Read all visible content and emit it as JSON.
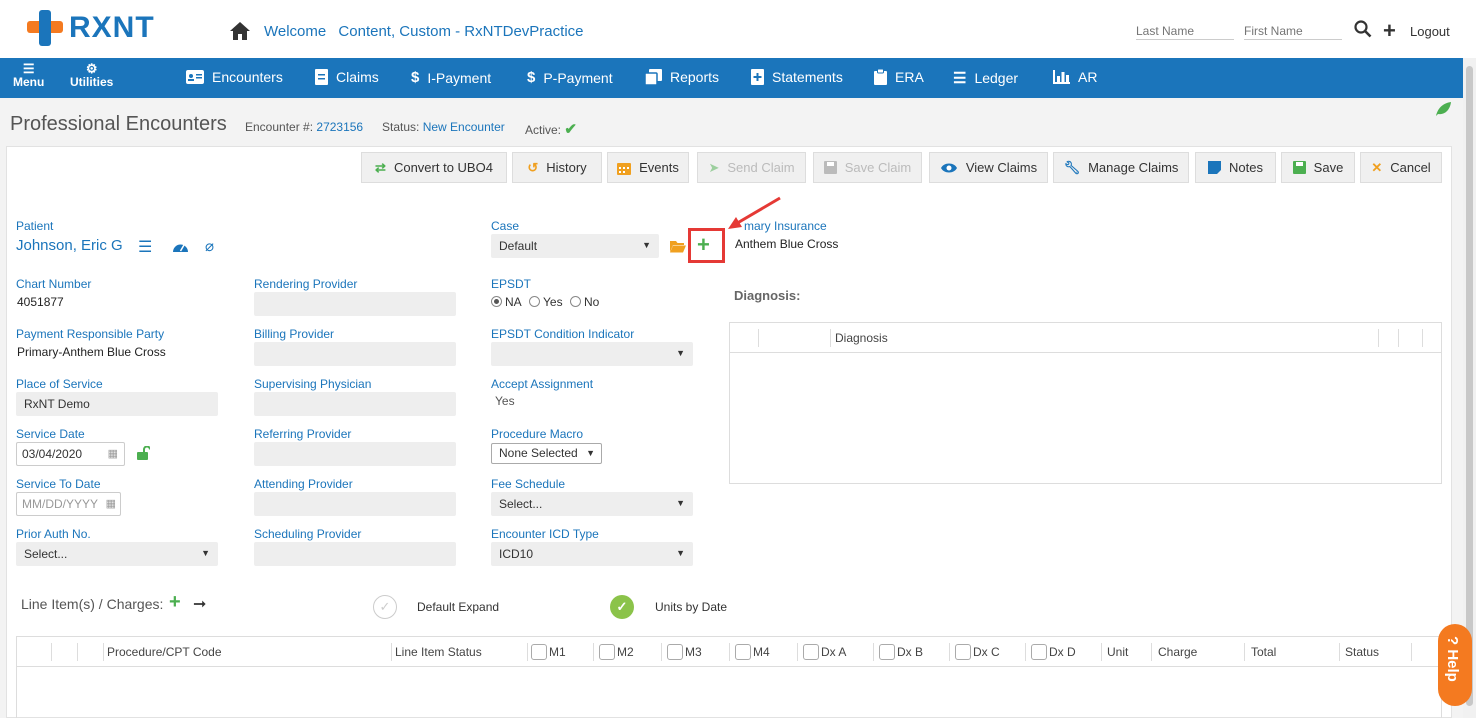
{
  "brand": {
    "logo_text": "RXNT"
  },
  "header": {
    "welcome_label": "Welcome",
    "user": "Content, Custom - RxNTDevPractice",
    "last_name_placeholder": "Last Name",
    "first_name_placeholder": "First Name",
    "logout": "Logout"
  },
  "nav": {
    "menu": "Menu",
    "utilities": "Utilities",
    "items": [
      {
        "label": "Encounters",
        "icon": "id-card-icon"
      },
      {
        "label": "Claims",
        "icon": "document-icon"
      },
      {
        "label": "I-Payment",
        "icon": "dollar-icon"
      },
      {
        "label": "P-Payment",
        "icon": "dollar-icon"
      },
      {
        "label": "Reports",
        "icon": "copy-icon"
      },
      {
        "label": "Statements",
        "icon": "file-plus-icon"
      },
      {
        "label": "ERA",
        "icon": "clipboard-icon"
      },
      {
        "label": "Ledger",
        "icon": "list-icon"
      },
      {
        "label": "AR",
        "icon": "bar-chart-icon"
      }
    ]
  },
  "page": {
    "title": "Professional Encounters",
    "encounter_label": "Encounter #:",
    "encounter_number": "2723156",
    "status_label": "Status:",
    "status_value": "New Encounter",
    "active_label": "Active:"
  },
  "toolbar": {
    "convert": "Convert to UBO4",
    "history": "History",
    "events": "Events",
    "send_claim": "Send Claim",
    "save_claim": "Save Claim",
    "view_claims": "View Claims",
    "manage_claims": "Manage Claims",
    "notes": "Notes",
    "save": "Save",
    "cancel": "Cancel"
  },
  "form": {
    "patient_label": "Patient",
    "patient_name": "Johnson, Eric G",
    "chart_number_label": "Chart Number",
    "chart_number": "4051877",
    "payment_party_label": "Payment Responsible Party",
    "payment_party": "Primary-Anthem Blue Cross",
    "place_of_service_label": "Place of Service",
    "place_of_service": "RxNT Demo",
    "service_date_label": "Service Date",
    "service_date": "03/04/2020",
    "service_to_date_label": "Service To Date",
    "service_to_date_placeholder": "MM/DD/YYYY",
    "prior_auth_label": "Prior Auth No.",
    "prior_auth_value": "Select...",
    "rendering_provider_label": "Rendering Provider",
    "billing_provider_label": "Billing Provider",
    "supervising_physician_label": "Supervising Physician",
    "referring_provider_label": "Referring Provider",
    "attending_provider_label": "Attending Provider",
    "scheduling_provider_label": "Scheduling Provider",
    "case_label": "Case",
    "case_value": "Default",
    "epsdt_label": "EPSDT",
    "epsdt_options": [
      "NA",
      "Yes",
      "No"
    ],
    "epsdt_condition_label": "EPSDT Condition Indicator",
    "accept_assignment_label": "Accept Assignment",
    "accept_assignment_value": "Yes",
    "procedure_macro_label": "Procedure Macro",
    "procedure_macro_value": "None Selected",
    "fee_schedule_label": "Fee Schedule",
    "fee_schedule_value": "Select...",
    "icd_type_label": "Encounter ICD Type",
    "icd_type_value": "ICD10",
    "primary_insurance_label": "mary Insurance",
    "primary_insurance": "Anthem Blue Cross",
    "diagnosis_title": "Diagnosis:",
    "diagnosis_column": "Diagnosis"
  },
  "line_items": {
    "title": "Line Item(s) / Charges:",
    "default_expand": "Default Expand",
    "units_by_date": "Units by Date",
    "columns": [
      "Procedure/CPT Code",
      "Line Item Status",
      "M1",
      "M2",
      "M3",
      "M4",
      "Dx A",
      "Dx B",
      "Dx C",
      "Dx D",
      "Unit",
      "Charge",
      "Total",
      "Status"
    ]
  },
  "help": {
    "label": "? Help"
  },
  "colors": {
    "brand_blue": "#1b75bb",
    "brand_orange": "#f47a20",
    "highlight": "#e53935",
    "green": "#4caf50"
  }
}
